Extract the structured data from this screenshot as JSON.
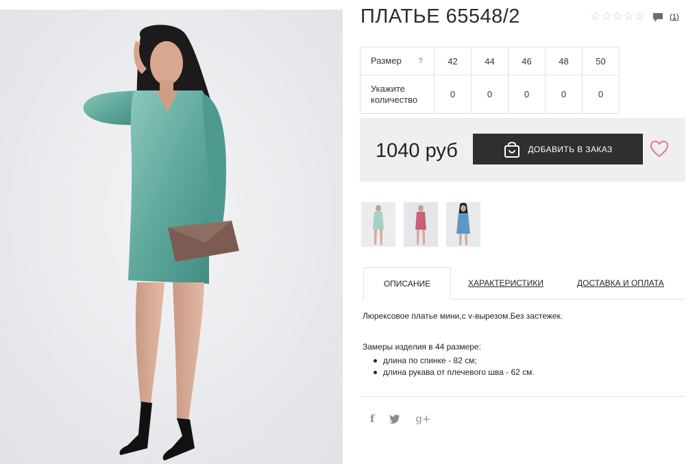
{
  "product": {
    "title": "ПЛАТЬЕ 65548/2",
    "rating_stars": 0,
    "review_count": "(1)",
    "price": "1040 руб",
    "add_to_order": "ДОБАВИТЬ В ЗАКАЗ"
  },
  "size_table": {
    "size_label": "Размер",
    "help": "?",
    "sizes": [
      "42",
      "44",
      "46",
      "48",
      "50"
    ],
    "qty_label_1": "Укажите",
    "qty_label_2": "количество",
    "quantities": [
      "0",
      "0",
      "0",
      "0",
      "0"
    ]
  },
  "thumbnails": [
    {
      "name": "mint-dress",
      "color": "#a7cfc6"
    },
    {
      "name": "pink-dress",
      "color": "#c8607a"
    },
    {
      "name": "blue-dress",
      "color": "#5d97c9"
    }
  ],
  "tabs": [
    "ОПИСАНИЕ",
    "ХАРАКТЕРИСТИКИ",
    "ДОСТАВКА И ОПЛАТА"
  ],
  "description": {
    "text": "Люрексовое платье мини,с v-вырезом.Без застежек.",
    "measure_title": "Замеры изделия в 44 размере:",
    "measures": [
      "длина по спинке - 82 см;",
      "длина рукава от плечевого шва - 62 см."
    ]
  },
  "social": {
    "facebook": "f",
    "twitter": "twitter-icon",
    "google": "g+"
  },
  "colors": {
    "accent_heart": "#e0788a",
    "button_bg": "#2f2f2f",
    "price_bar_bg": "#efeff1",
    "dress": "#5fa89c"
  }
}
